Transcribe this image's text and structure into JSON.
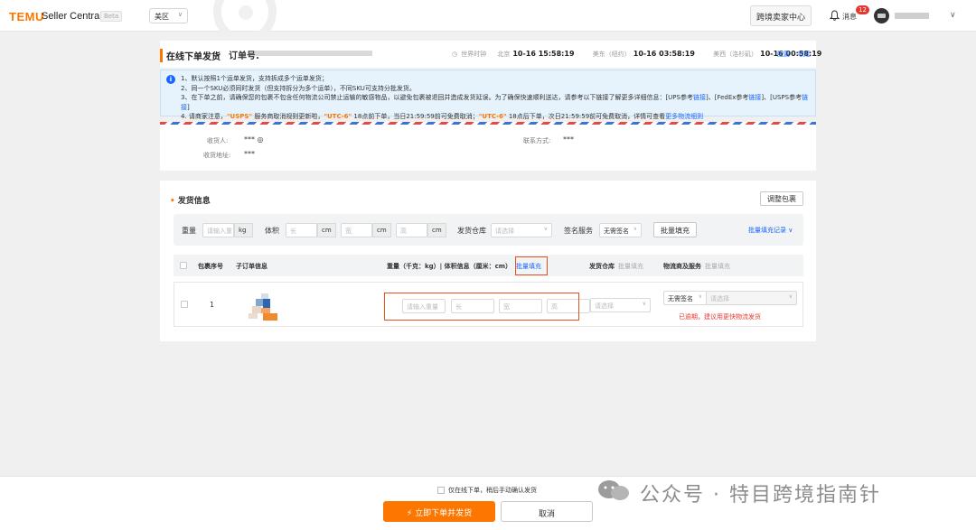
{
  "topbar": {
    "logo": "TEMU",
    "product": "Seller Central",
    "beta": "Beta",
    "region": "美区",
    "cross_border_btn": "跨境卖家中心",
    "messages_label": "消息",
    "messages_count": "12"
  },
  "header": {
    "page_title": "在线下单发货",
    "order_label": "订单号:",
    "world_clock": "世界时钟",
    "clocks": [
      {
        "city": "北京",
        "time": "10-16 15:58:19"
      },
      {
        "city": "美东（纽约）",
        "time": "10-16 03:58:19"
      },
      {
        "city": "美西（洛杉矶）",
        "time": "10-16 00:58:19"
      }
    ],
    "config": "配置",
    "collapse": "收起"
  },
  "notice": {
    "line1": "1、默认按照1个运单发货，支持拆成多个运单发货；",
    "line2": "2、同一个SKU必须同时发货（但支持拆分为多个运单），不同SKU可支持分批发货。",
    "line3": "3、在下单之前，请确保您的包裹不包含任何物流公司禁止运输的敏感物品，以避免包裹被退回并造成发货延误。为了确保快速顺利送达，请参考以下链接了解更多详细信息：[UPS参考",
    "line3_link1": "链接",
    "line3_mid1": "]、[FedEx参考",
    "line3_link2": "链接",
    "line3_mid2": "]、[USPS参考",
    "line3_link3": "链接",
    "line3_end": "]",
    "line4_a": "4. 请商家注意，",
    "line4_usps": "\"USPS\"",
    "line4_b": "服务商取消规则更新啦，",
    "line4_utc1": "\"UTC-6\"",
    "line4_c": "18点前下单，当日21:59:59前可免费取消；",
    "line4_utc2": "\"UTC-6\"",
    "line4_d": "18点后下单，次日21:59:59前可免费取消，详情可查看",
    "line4_link": "更多物流细则"
  },
  "address": {
    "recipient_label": "收货人:",
    "recipient_value": "*** ◎",
    "address_label": "收货地址:",
    "address_value": "***",
    "contact_label": "联系方式:",
    "contact_value": "***"
  },
  "shipping": {
    "section_title": "发货信息",
    "adjust_btn": "调整包裹",
    "bulk": {
      "weight_label": "重量",
      "weight_placeholder": "请输入重",
      "weight_unit": "kg",
      "volume_label": "体积",
      "len_placeholder": "长",
      "wid_placeholder": "宽",
      "hei_placeholder": "高",
      "cm": "cm",
      "warehouse_label": "发货仓库",
      "warehouse_placeholder": "请选择",
      "sign_label": "签名服务",
      "sign_value": "无需签名",
      "fill_btn": "批量填充",
      "record_link": "批量填充记录 ∨"
    },
    "table": {
      "col_no": "包裹序号",
      "col_sub": "子订单信息",
      "col_dims": "重量（千克：kg）| 体积信息（厘米：cm）",
      "col_dims_bulk": "批量填充",
      "col_wh": "发货仓库",
      "col_wh_bulk": "批量填充",
      "col_svc": "物流商及服务",
      "col_svc_bulk": "批量填充"
    },
    "row": {
      "index": "1",
      "weight_placeholder": "请输入重量",
      "len_placeholder": "长",
      "wid_placeholder": "宽",
      "hei_placeholder": "高",
      "warehouse_placeholder": "请选择",
      "sign_value": "无需签名",
      "service_placeholder": "请选择",
      "late_warning": "已逾期，建议用更快物流发货"
    }
  },
  "footer": {
    "checkbox_label": "仅在线下单，稍后手动确认发货",
    "submit": "⚡ 立即下单并发货",
    "cancel": "取消"
  },
  "watermark": "公众号 · 特目跨境指南针",
  "colors": {
    "brand": "#fb7701",
    "link": "#1a66ff",
    "alert": "#e5362f",
    "highlight_box": "#e94e21"
  }
}
